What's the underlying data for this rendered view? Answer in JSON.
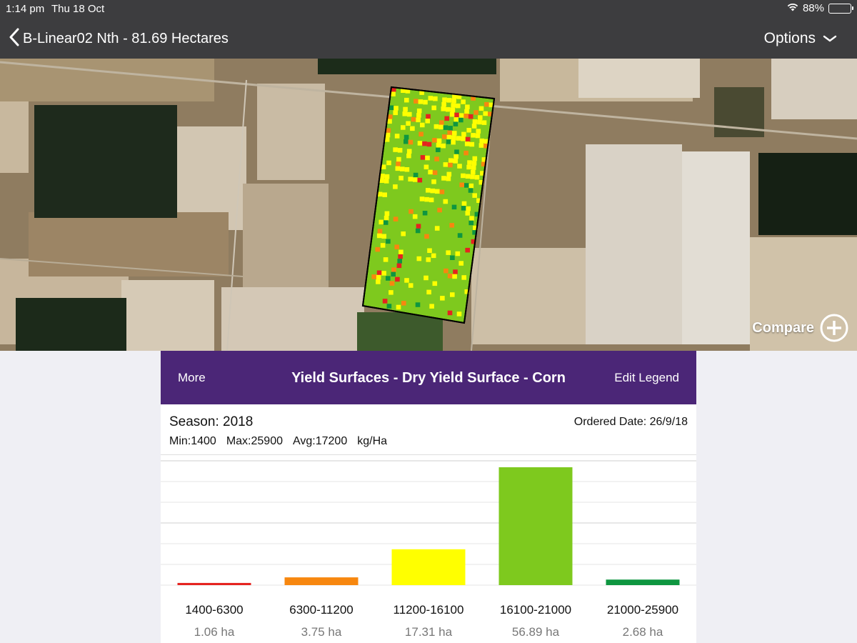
{
  "status": {
    "time": "1:14 pm",
    "date": "Thu 18 Oct",
    "battery": "88%",
    "battery_level": 0.88
  },
  "nav": {
    "title": "B-Linear02 Nth - 81.69 Hectares",
    "options_label": "Options"
  },
  "map": {
    "compare_label": "Compare"
  },
  "panel": {
    "more_label": "More",
    "title": "Yield Surfaces - Dry Yield Surface - Corn",
    "edit_legend_label": "Edit Legend",
    "season": "Season: 2018",
    "ordered_date": "Ordered Date: 26/9/18",
    "stats": {
      "min": "Min:1400",
      "max": "Max:25900",
      "avg": "Avg:17200",
      "unit": "kg/Ha"
    }
  },
  "chart_data": {
    "type": "bar",
    "categories": [
      "1400-6300",
      "6300-11200",
      "11200-16100",
      "16100-21000",
      "21000-25900"
    ],
    "values": [
      1.06,
      3.75,
      17.31,
      56.89,
      2.68
    ],
    "value_labels": [
      "1.06 ha",
      "3.75 ha",
      "17.31 ha",
      "56.89 ha",
      "2.68 ha"
    ],
    "colors": [
      "#e5231f",
      "#f7870f",
      "#ffff00",
      "#7ec91e",
      "#0e9640"
    ],
    "ylim": [
      0,
      60
    ],
    "grid": true
  },
  "colors": {
    "nav_bg": "#3d3d3f",
    "panel_header": "#4b2677",
    "yield_red": "#e5231f",
    "yield_orange": "#f7870f",
    "yield_yellow": "#ffff00",
    "yield_light_green": "#7ec91e",
    "yield_dark_green": "#0e9640"
  }
}
